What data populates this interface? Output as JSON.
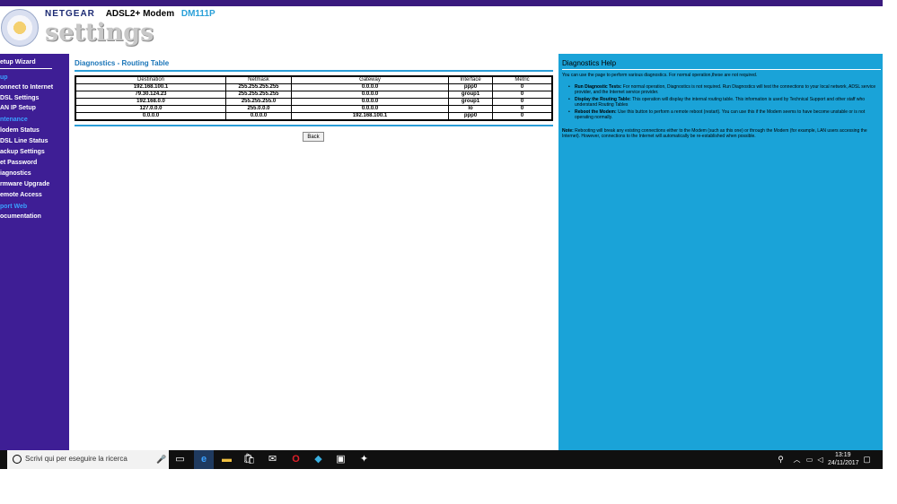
{
  "header": {
    "brand": "NETGEAR",
    "product": "ADSL2+ Modem",
    "model": "DM111P",
    "settings_word": "settings"
  },
  "sidebar": {
    "items": [
      {
        "label": "etup Wizard",
        "kind": "title"
      },
      {
        "label": "up",
        "kind": "section"
      },
      {
        "label": "onnect to Internet",
        "kind": "item"
      },
      {
        "label": "DSL Settings",
        "kind": "item"
      },
      {
        "label": "AN IP Setup",
        "kind": "item"
      },
      {
        "label": "ntenance",
        "kind": "section"
      },
      {
        "label": "lodem Status",
        "kind": "item"
      },
      {
        "label": "DSL Line Status",
        "kind": "item"
      },
      {
        "label": "ackup Settings",
        "kind": "item"
      },
      {
        "label": "et Password",
        "kind": "item"
      },
      {
        "label": "iagnostics",
        "kind": "item"
      },
      {
        "label": "rmware Upgrade",
        "kind": "item"
      },
      {
        "label": "emote Access",
        "kind": "item"
      },
      {
        "label": "port Web",
        "kind": "section"
      },
      {
        "label": "ocumentation",
        "kind": "item"
      }
    ]
  },
  "main": {
    "title": "Diagnostics - Routing Table",
    "columns": [
      "Destination",
      "Netmask",
      "Gateway",
      "Interface",
      "Metric"
    ],
    "rows": [
      [
        "192.168.100.1",
        "255.255.255.255",
        "0.0.0.0",
        "ppp0",
        "0"
      ],
      [
        "79.30.124.23",
        "255.255.255.255",
        "0.0.0.0",
        "group1",
        "0"
      ],
      [
        "192.168.0.0",
        "255.255.255.0",
        "0.0.0.0",
        "group1",
        "0"
      ],
      [
        "127.0.0.0",
        "255.0.0.0",
        "0.0.0.0",
        "lo",
        "0"
      ],
      [
        "0.0.0.0",
        "0.0.0.0",
        "192.168.100.1",
        "ppp0",
        "0"
      ]
    ],
    "back_label": "Back"
  },
  "help": {
    "title": "Diagnostics Help",
    "intro": "You can use the page to perform various diagnostics. For normal operation,these are not required.",
    "bullets": [
      {
        "head": "Run Diagnostic Tests:",
        "body": " For normal operation, Diagnostics is not required. Run Diagnostics will test the connections to your local network, ADSL service provider, and the Internet service provider."
      },
      {
        "head": "Display the Routing Table:",
        "body": " This operation will display the internal routing table. This information is used by Technical Support and other staff who understand Routing Tables"
      },
      {
        "head": "Reboot the Modem:",
        "body": " Use this button to perform a remote reboot (restart). You can use this if the Modem seems to have become unstable or is not operating normally."
      }
    ],
    "note_head": "Note:",
    "note_body": " Rebooting will break any existing connections either to the Modem (such as this one) or through the Modem (for example, LAN users accessing the Internet). However, connections to the Internet will automatically be re-established when possible."
  },
  "taskbar": {
    "search_placeholder": "Scrivi qui per eseguire la ricerca",
    "time": "13:19",
    "date": "24/11/2017"
  }
}
